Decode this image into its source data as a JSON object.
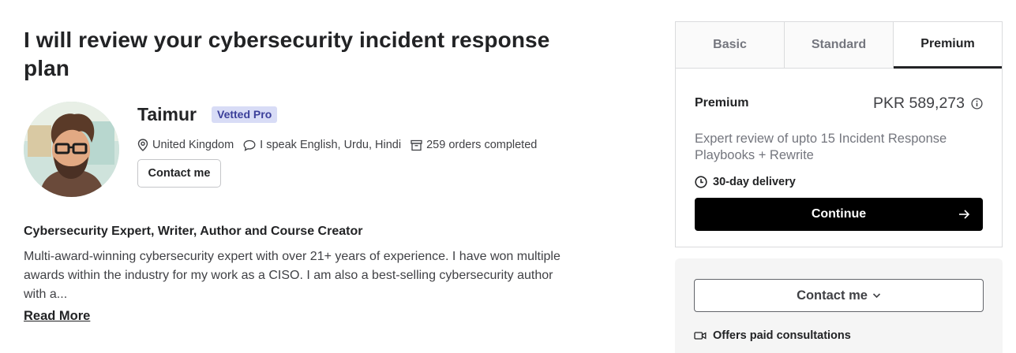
{
  "gig": {
    "title": "I will review your cybersecurity incident response plan"
  },
  "seller": {
    "name": "Taimur",
    "badge": "Vetted Pro",
    "location": "United Kingdom",
    "languages": "I speak English, Urdu, Hindi",
    "orders": "259 orders completed",
    "contact_label": "Contact me",
    "headline": "Cybersecurity Expert, Writer, Author and Course Creator",
    "description": "Multi-award-winning cybersecurity expert with over 21+ years of experience. I have won multiple awards within the industry for my work as a CISO. I am also a best-selling cybersecurity author with a...",
    "read_more": "Read More"
  },
  "package": {
    "tabs": [
      {
        "label": "Basic",
        "active": false
      },
      {
        "label": "Standard",
        "active": false
      },
      {
        "label": "Premium",
        "active": true
      }
    ],
    "name": "Premium",
    "price": "PKR 589,273",
    "description": "Expert review of upto 15 Incident Response Playbooks + Rewrite",
    "delivery": "30-day delivery",
    "continue_label": "Continue"
  },
  "contact_panel": {
    "button_label": "Contact me",
    "consultation": "Offers paid consultations"
  },
  "icons": {
    "location": "location-pin-icon",
    "languages": "speech-bubble-icon",
    "orders": "box-icon",
    "price_info": "info-icon",
    "delivery": "clock-icon",
    "continue": "arrow-right-icon",
    "contact_dropdown": "chevron-down-icon",
    "consultation": "video-camera-icon"
  },
  "colors": {
    "badge_bg": "#d8dcf6",
    "badge_text": "#3b3f9a",
    "primary_button": "#000000",
    "text_dark": "#222325",
    "text_muted": "#74767e"
  }
}
